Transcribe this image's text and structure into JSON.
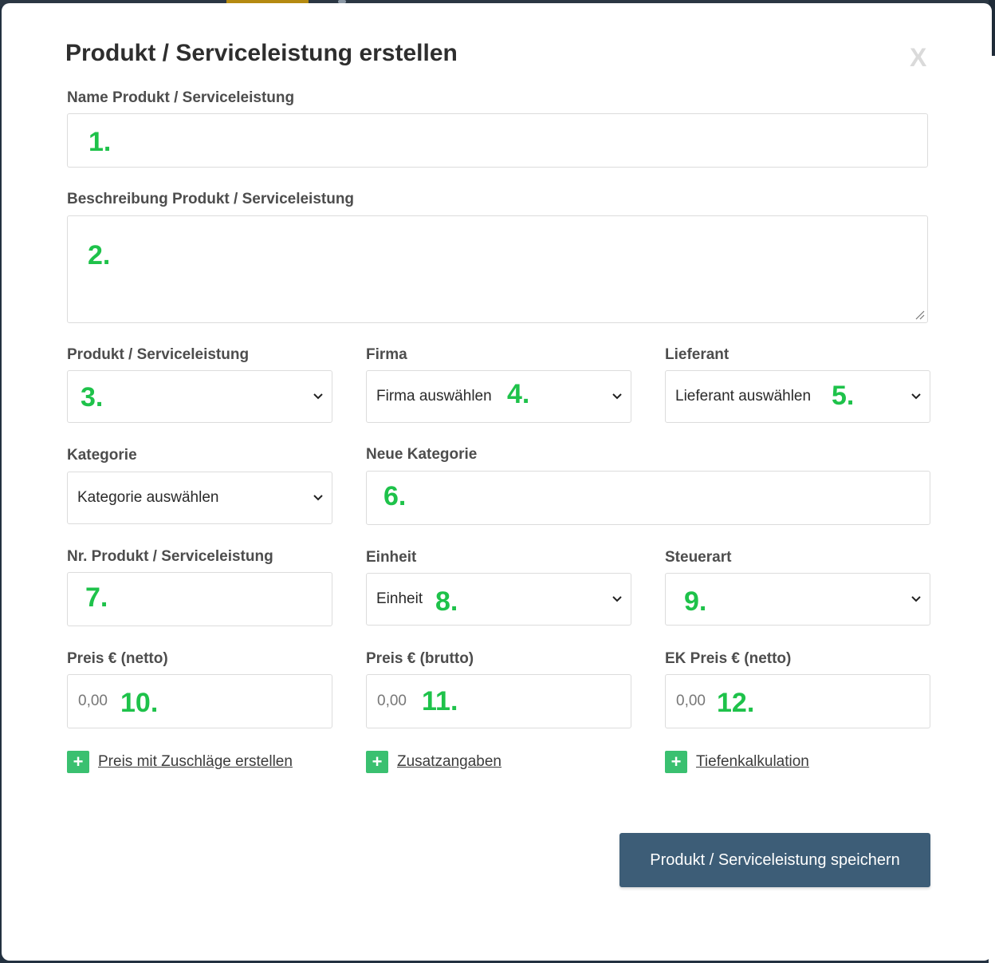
{
  "modal": {
    "title": "Produkt / Serviceleistung erstellen",
    "close_label": "X"
  },
  "fields": {
    "name": {
      "label": "Name Produkt / Serviceleistung",
      "marker": "1."
    },
    "description": {
      "label": "Beschreibung Produkt / Serviceleistung",
      "marker": "2."
    },
    "type": {
      "label": "Produkt / Serviceleistung",
      "value": "",
      "marker": "3."
    },
    "company": {
      "label": "Firma",
      "value": "Firma auswählen",
      "marker": "4."
    },
    "supplier": {
      "label": "Lieferant",
      "value": "Lieferant auswählen",
      "marker": "5."
    },
    "category": {
      "label": "Kategorie",
      "value": "Kategorie auswählen"
    },
    "new_category": {
      "label": "Neue Kategorie",
      "marker": "6."
    },
    "number": {
      "label": "Nr. Produkt / Serviceleistung",
      "marker": "7."
    },
    "unit": {
      "label": "Einheit",
      "value": "Einheit",
      "marker": "8."
    },
    "tax": {
      "label": "Steuerart",
      "value": "",
      "marker": "9."
    },
    "price_net": {
      "label": "Preis € (netto)",
      "placeholder": "0,00",
      "marker": "10."
    },
    "price_gross": {
      "label": "Preis € (brutto)",
      "placeholder": "0,00",
      "marker": "11."
    },
    "purchase_price_net": {
      "label": "EK Preis € (netto)",
      "placeholder": "0,00",
      "marker": "12."
    }
  },
  "links": {
    "surcharges": "Preis mit Zuschläge erstellen",
    "additional_info": "Zusatzangaben",
    "deep_calculation": "Tiefenkalkulation",
    "plus_symbol": "+"
  },
  "save_button": "Produkt / Serviceleistung speichern",
  "colors": {
    "primary_button": "#3d5d77",
    "plus_badge": "#3ac070",
    "marker": "#1ec24a"
  }
}
